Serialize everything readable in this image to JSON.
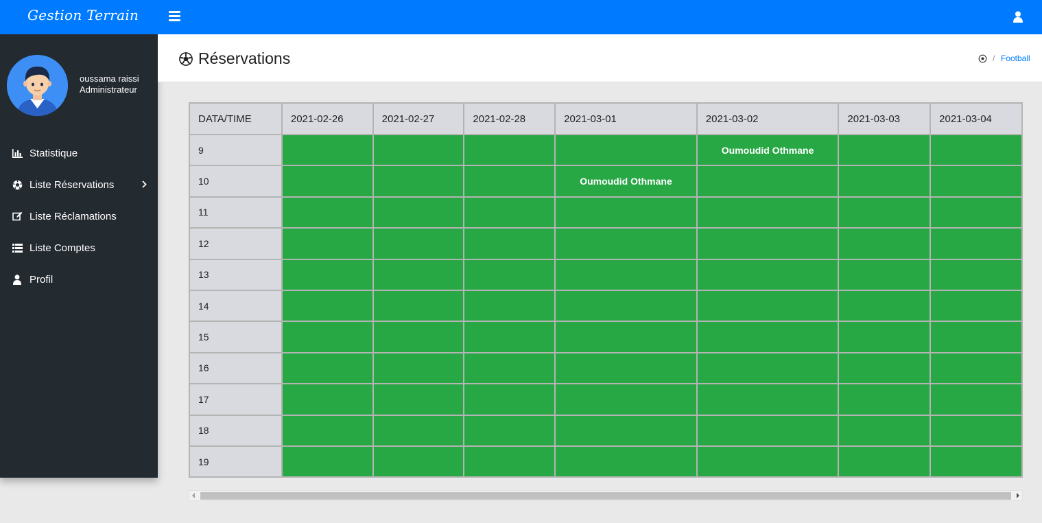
{
  "app": {
    "brand": "Gestion Terrain"
  },
  "profile": {
    "name": "oussama raissi",
    "role": "Administrateur"
  },
  "sidebar": {
    "items": [
      {
        "label": "Statistique",
        "icon": "bar-chart-icon"
      },
      {
        "label": "Liste Réservations",
        "icon": "soccer-ball-icon",
        "has_submenu": true
      },
      {
        "label": "Liste Réclamations",
        "icon": "edit-icon"
      },
      {
        "label": "Liste Comptes",
        "icon": "list-icon"
      },
      {
        "label": "Profil",
        "icon": "user-icon"
      }
    ]
  },
  "header": {
    "title": "Réservations",
    "breadcrumb": {
      "separator": "/",
      "current": "Football"
    }
  },
  "schedule": {
    "corner_label": "DATA/TIME",
    "dates": [
      "2021-02-26",
      "2021-02-27",
      "2021-02-28",
      "2021-03-01",
      "2021-03-02",
      "2021-03-03",
      "2021-03-04"
    ],
    "hours": [
      "9",
      "10",
      "11",
      "12",
      "13",
      "14",
      "15",
      "16",
      "17",
      "18",
      "19"
    ],
    "reservations": [
      {
        "hour": "9",
        "date": "2021-03-02",
        "name": "Oumoudid Othmane"
      },
      {
        "hour": "10",
        "date": "2021-03-01",
        "name": "Oumoudid Othmane"
      }
    ]
  },
  "colors": {
    "navbar": "#007bff",
    "sidebar": "#232a30",
    "slot_available": "#28a745",
    "link": "#007bff"
  }
}
